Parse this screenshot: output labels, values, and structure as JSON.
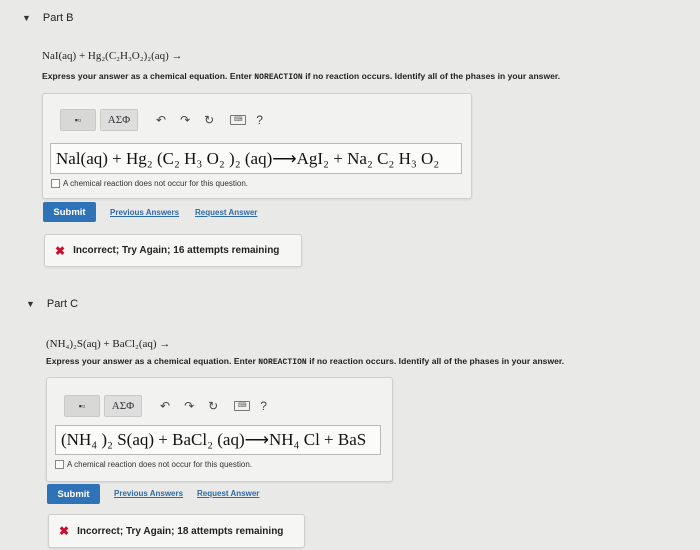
{
  "partB": {
    "title": "Part B",
    "reaction": "NaI(aq) + Hg₂(C₂H₃O₂)₂(aq) →",
    "instructions_pre": "Express your answer as a chemical equation. Enter ",
    "instructions_keyword": "NOREACTION",
    "instructions_post": " if no reaction occurs. Identify all of the phases in your answer.",
    "toolbar": {
      "greek": "ΑΣΦ",
      "help": "?"
    },
    "answer": "Nal(aq) + Hg₂ (C₂ H₃ O₂ )₂ (aq)⟶AgI₂ + Na₂ C₂ H₃ O₂",
    "checkbox_label": "A chemical reaction does not occur for this question.",
    "submit": "Submit",
    "previous_answers": "Previous Answers",
    "request_answer": "Request Answer",
    "feedback": "Incorrect; Try Again; 16 attempts remaining"
  },
  "partC": {
    "title": "Part C",
    "reaction": "(NH₄)₂S(aq) + BaCl₂(aq) →",
    "instructions_pre": "Express your answer as a chemical equation. Enter ",
    "instructions_keyword": "NOREACTION",
    "instructions_post": " if no reaction occurs. Identify all of the phases in your answer.",
    "toolbar": {
      "greek": "ΑΣΦ",
      "help": "?"
    },
    "answer": "(NH₄ )₂ S(aq) + BaCl₂ (aq)⟶NH₄ Cl + BaS",
    "checkbox_label": "A chemical reaction does not occur for this question.",
    "submit": "Submit",
    "previous_answers": "Previous Answers",
    "request_answer": "Request Answer",
    "feedback": "Incorrect; Try Again; 18 attempts remaining"
  },
  "colors": {
    "accent": "#2e73b8",
    "error": "#c8102e",
    "background": "#e9e9e7"
  },
  "icons": [
    "caret-down-icon",
    "template-icon",
    "undo-icon",
    "redo-icon",
    "reset-icon",
    "keyboard-icon",
    "help-icon",
    "x-icon"
  ]
}
